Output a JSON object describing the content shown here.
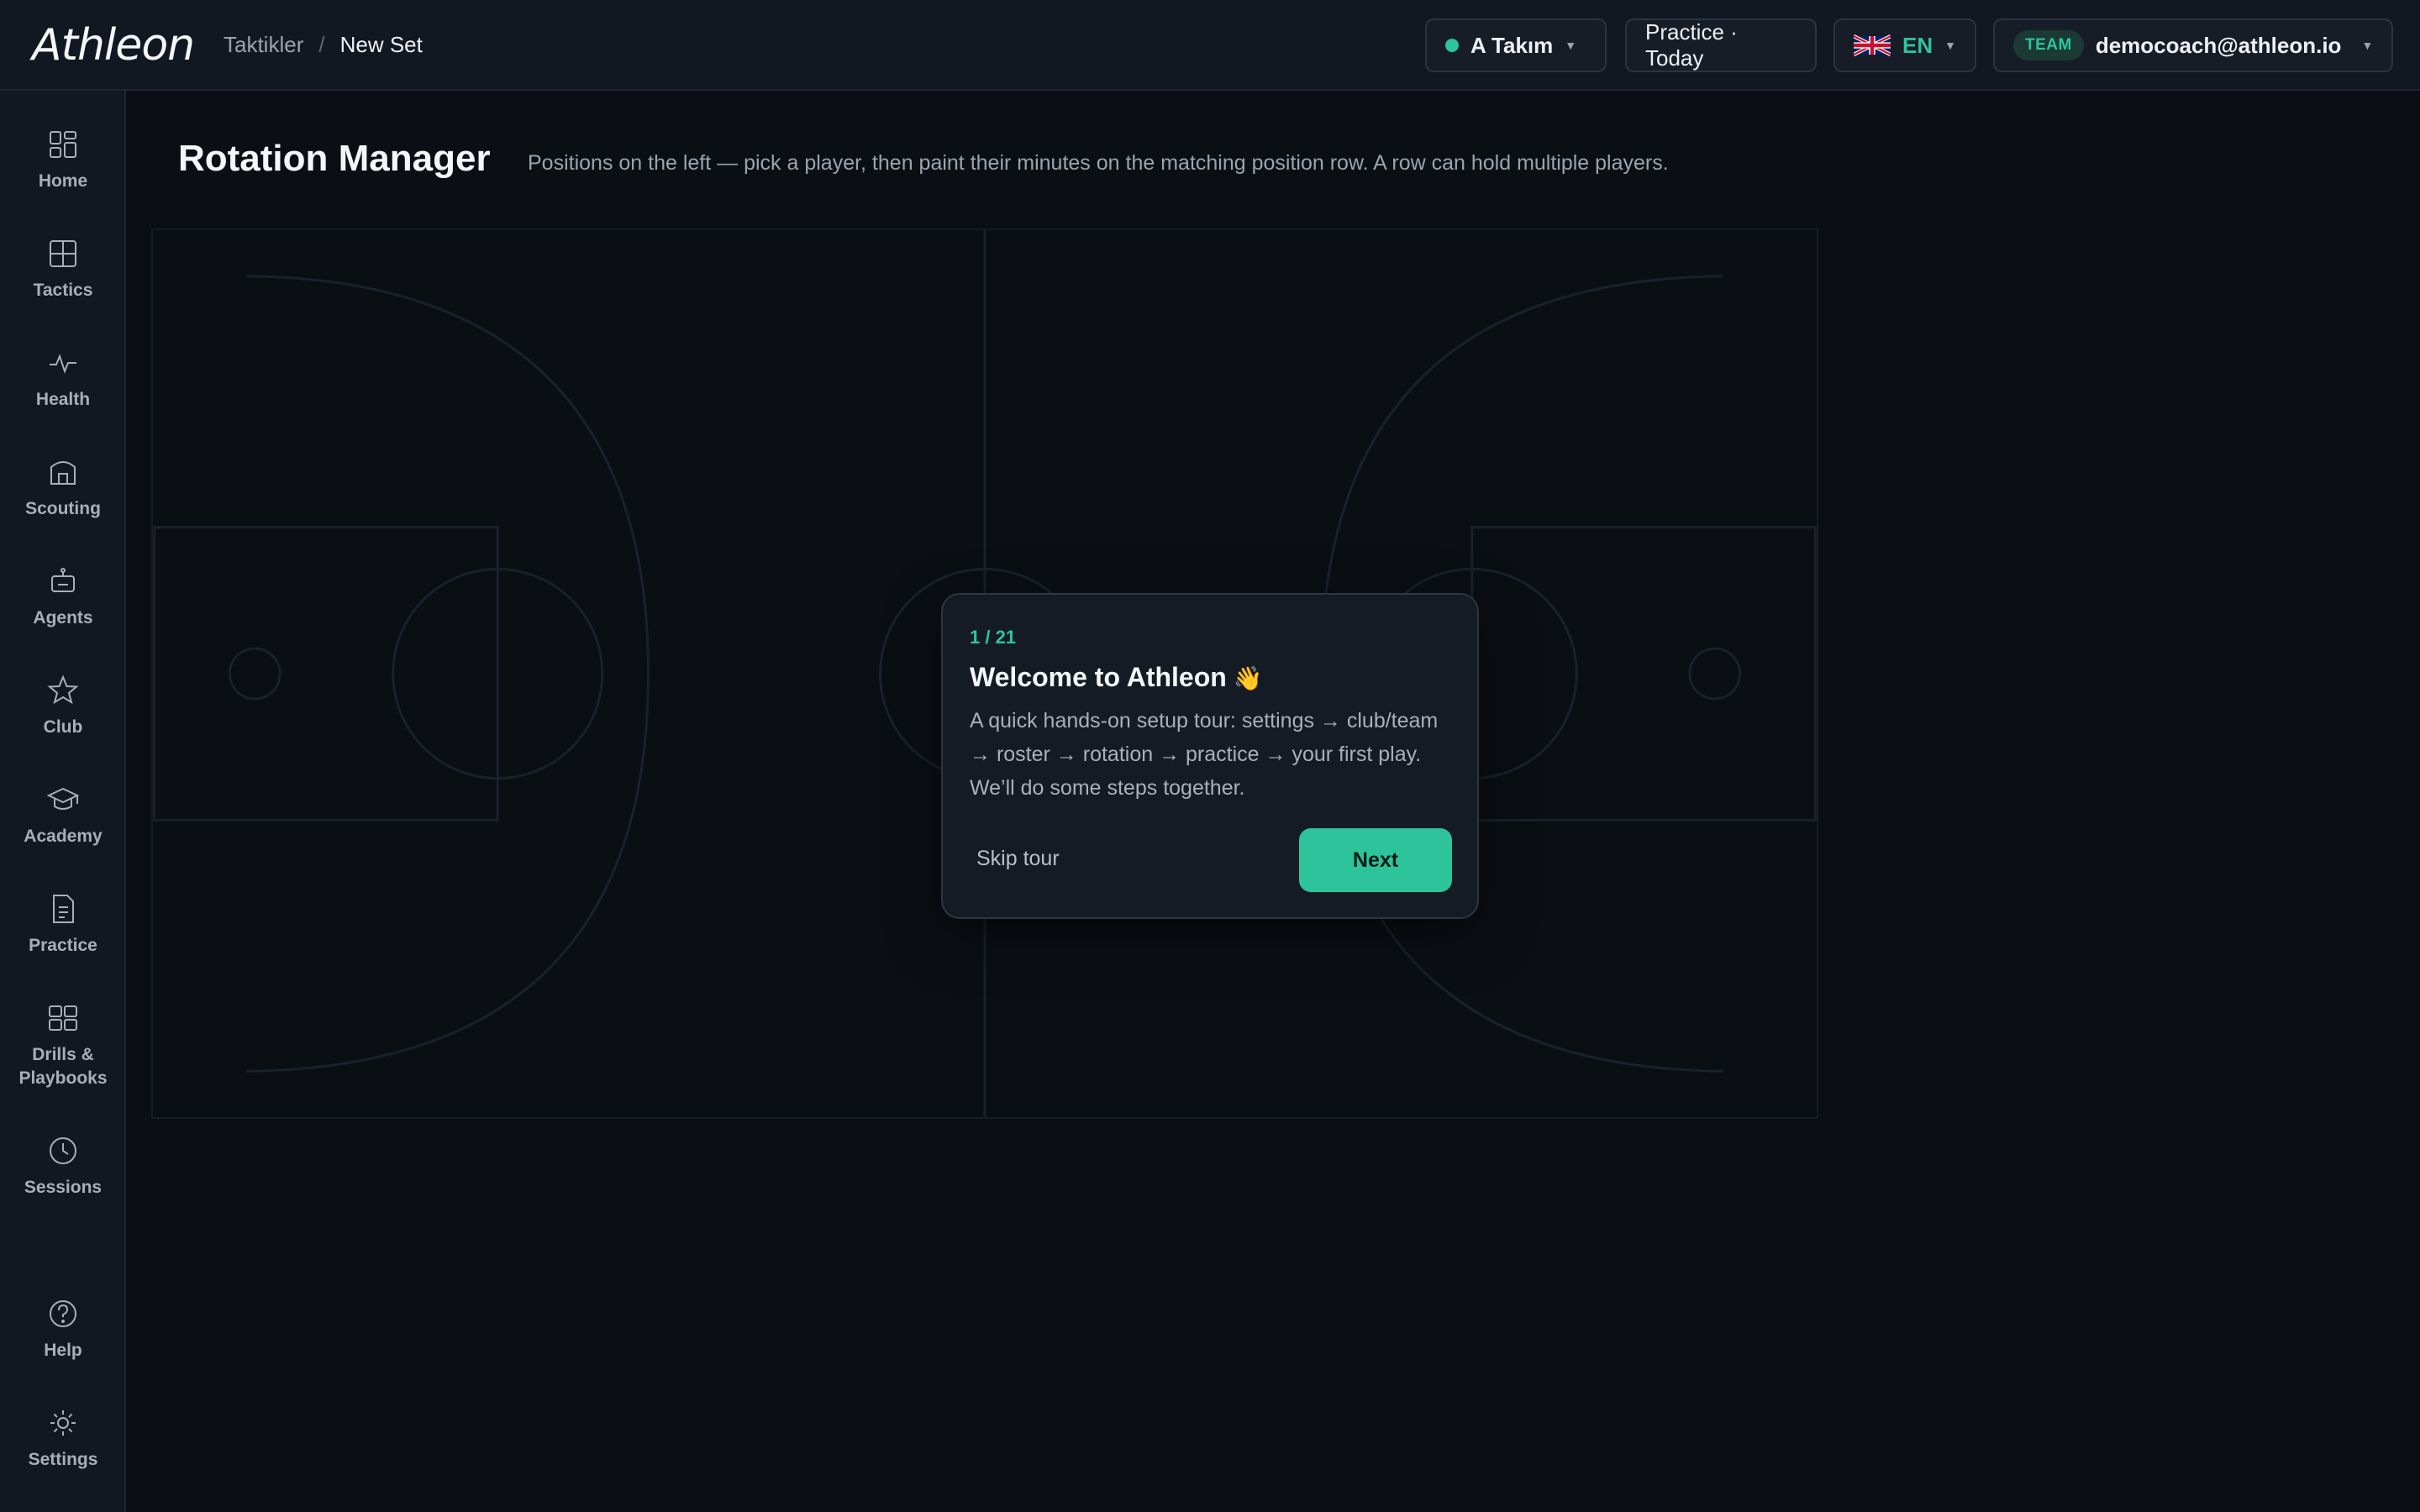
{
  "app": {
    "logo": "Athleon"
  },
  "breadcrumb": {
    "parent": "Taktikler",
    "separator": "/",
    "current": "New Set"
  },
  "header": {
    "team_label": "A Takım",
    "practice_label": "Practice · Today",
    "language_label": "EN",
    "user_badge": "TEAM",
    "user_email": "democoach@athleon.io"
  },
  "sidebar": {
    "items": [
      {
        "label": "Home",
        "icon": "grid-icon"
      },
      {
        "label": "Tactics",
        "icon": "board-icon"
      },
      {
        "label": "Health",
        "icon": "pulse-icon"
      },
      {
        "label": "Scouting",
        "icon": "building-icon"
      },
      {
        "label": "Agents",
        "icon": "robot-icon"
      },
      {
        "label": "Club",
        "icon": "star-icon"
      },
      {
        "label": "Academy",
        "icon": "graduation-cap-icon"
      },
      {
        "label": "Practice",
        "icon": "document-icon"
      },
      {
        "label": "Drills & Playbooks",
        "icon": "tiles-icon"
      },
      {
        "label": "Sessions",
        "icon": "clock-icon"
      }
    ],
    "bottom": [
      {
        "label": "Help",
        "icon": "help-icon"
      },
      {
        "label": "Settings",
        "icon": "gear-icon"
      }
    ]
  },
  "main": {
    "title": "Rotation Manager",
    "subtitle": "Positions on the left — pick a player, then paint their minutes on the matching position row. A row can hold multiple players."
  },
  "tour": {
    "step": "1 / 21",
    "title": "Welcome to Athleon",
    "emoji": "👋",
    "body": "A quick hands-on setup tour: settings → club/team → roster → rotation → practice → your first play. We’ll do some steps together.",
    "skip_label": "Skip tour",
    "next_label": "Next"
  },
  "colors": {
    "accent": "#2ec49b",
    "background": "#0b0f14",
    "panel": "#121821"
  }
}
